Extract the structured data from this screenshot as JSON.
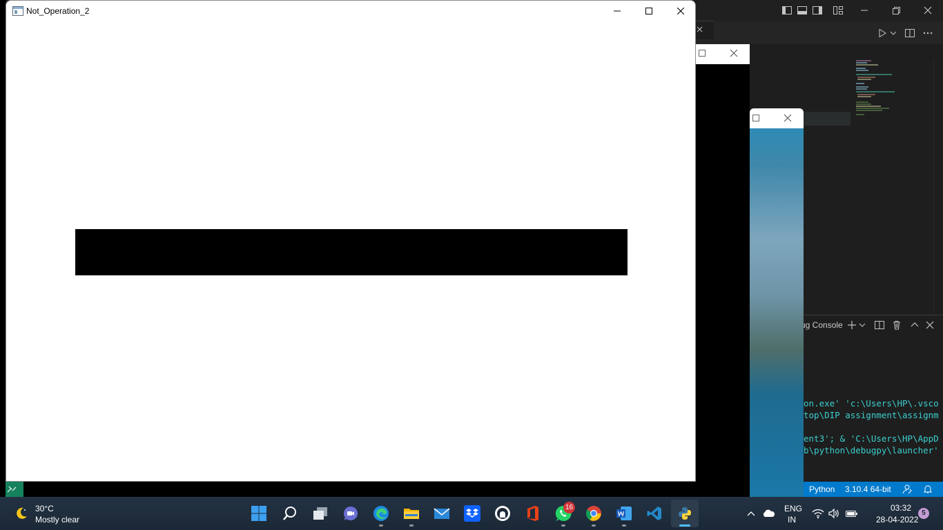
{
  "main_window": {
    "title": "Not_Operation_2",
    "image_colors": {
      "background": "#ffffff",
      "bar": "#000000"
    }
  },
  "vscode": {
    "panel_tab": "ug Console",
    "terminal_lines": [
      "on.exe' 'c:\\Users\\HP\\.vsco",
      "top\\DIP assignment\\assignm",
      "",
      "ent3'; & 'C:\\Users\\HP\\AppD",
      "b\\python\\debugpy\\launcher'"
    ],
    "status": {
      "language": "Python",
      "interpreter": "3.10.4 64-bit"
    },
    "accent": "#007acc"
  },
  "taskbar": {
    "weather": {
      "temp": "30°C",
      "desc": "Mostly clear",
      "icon": "moon-icon"
    },
    "apps": [
      {
        "name": "start",
        "icon": "windows-start-icon"
      },
      {
        "name": "search",
        "icon": "search-icon"
      },
      {
        "name": "task-view",
        "icon": "task-view-icon"
      },
      {
        "name": "chat",
        "icon": "teams-chat-icon"
      },
      {
        "name": "edge",
        "icon": "edge-icon"
      },
      {
        "name": "file-explorer",
        "icon": "folder-icon"
      },
      {
        "name": "mail",
        "icon": "mail-icon"
      },
      {
        "name": "dropbox",
        "icon": "dropbox-icon"
      },
      {
        "name": "github",
        "icon": "github-icon"
      },
      {
        "name": "office",
        "icon": "office-icon"
      },
      {
        "name": "whatsapp",
        "icon": "whatsapp-icon",
        "badge": "16"
      },
      {
        "name": "chrome",
        "icon": "chrome-icon"
      },
      {
        "name": "word",
        "icon": "word-icon"
      },
      {
        "name": "vscode",
        "icon": "vscode-icon"
      },
      {
        "name": "python",
        "icon": "python-icon"
      }
    ],
    "tray": {
      "lang_line1": "ENG",
      "lang_line2": "IN",
      "time": "03:32",
      "date": "28-04-2022",
      "notifications": "5"
    }
  }
}
